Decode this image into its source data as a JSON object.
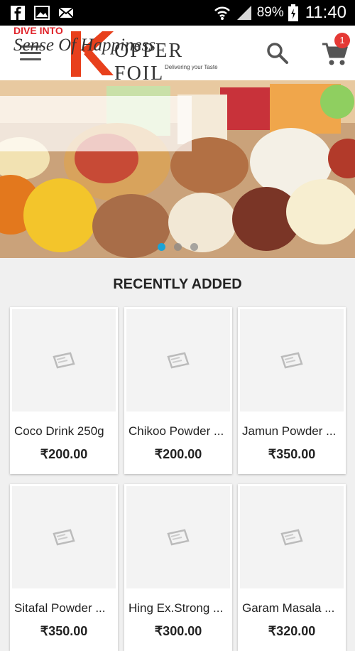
{
  "status_bar": {
    "battery": "89%",
    "time": "11:40",
    "left_icons": [
      "facebook-icon",
      "gallery-icon",
      "mail-icon"
    ],
    "right_icons": [
      "wifi-icon",
      "signal-icon",
      "battery-icon"
    ]
  },
  "header": {
    "logo_word": "OPPER FOIL",
    "logo_tagline": "Delivering your Taste",
    "cart_count": "1",
    "accent_color": "#e8401c"
  },
  "banner": {
    "kicker": "DIVE INTO",
    "headline": "Sense Of Happiness",
    "active_slide": 1,
    "slide_count": 3
  },
  "section": {
    "title": "RECENTLY ADDED"
  },
  "products": [
    {
      "name": "Coco Drink 250g",
      "price": "₹200.00"
    },
    {
      "name": "Chikoo Powder ...",
      "price": "₹200.00"
    },
    {
      "name": "Jamun Powder ...",
      "price": "₹350.00"
    },
    {
      "name": "Sitafal Powder ...",
      "price": "₹350.00"
    },
    {
      "name": "Hing Ex.Strong ...",
      "price": "₹300.00"
    },
    {
      "name": "Garam Masala ...",
      "price": "₹320.00"
    }
  ]
}
